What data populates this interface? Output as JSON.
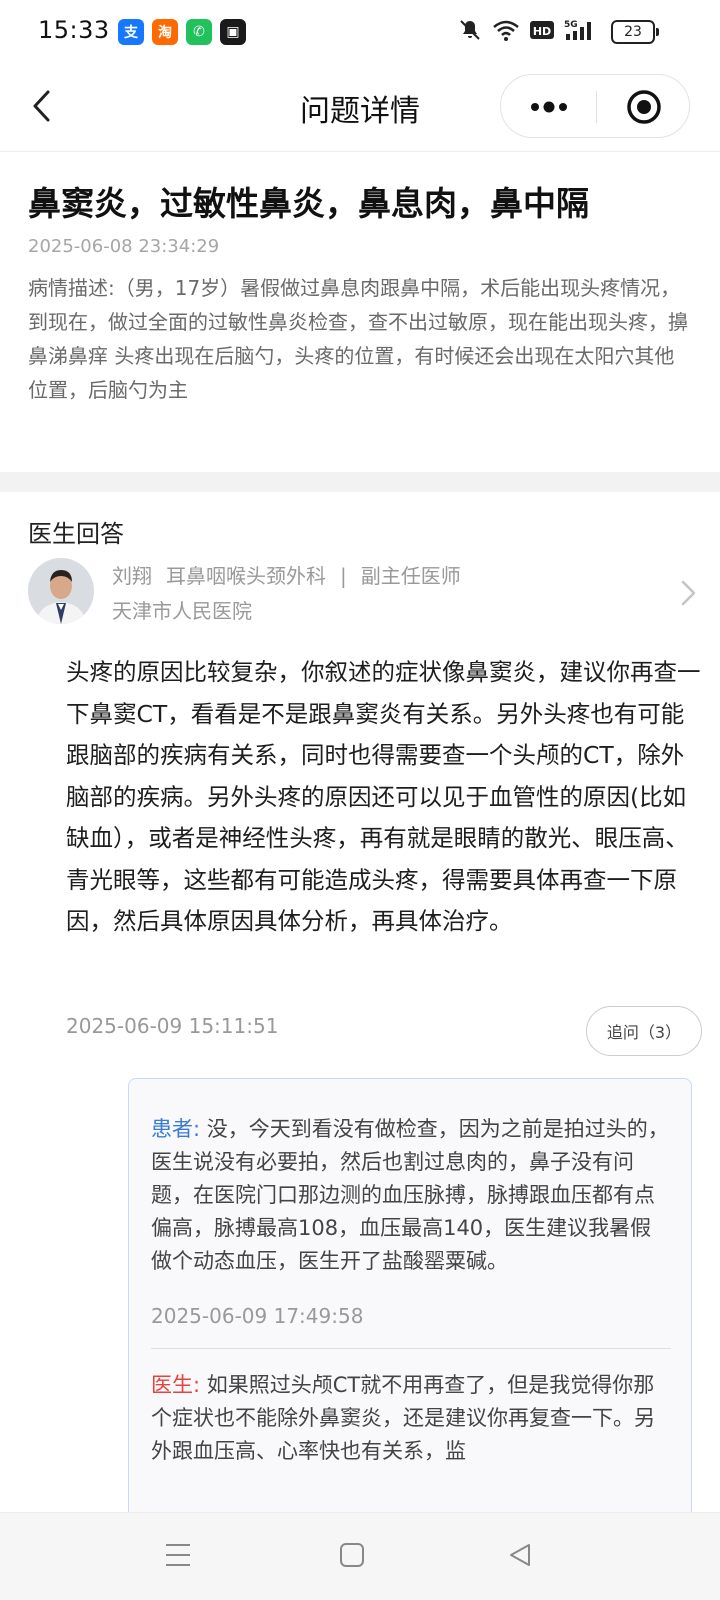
{
  "status_bar": {
    "time": "15:33",
    "apps": [
      {
        "name": "alipay-app-icon",
        "glyph": "支",
        "color": "#1677ff"
      },
      {
        "name": "taobao-app-icon",
        "glyph": "淘",
        "color": "#ff6a00"
      },
      {
        "name": "phone-app-icon",
        "glyph": "✆",
        "color": "#21c25e"
      },
      {
        "name": "recorder-app-icon",
        "glyph": "▣",
        "color": "#1a1a1a"
      }
    ],
    "battery": "23"
  },
  "nav": {
    "title": "问题详情"
  },
  "question": {
    "title": "鼻窦炎，过敏性鼻炎，鼻息肉，鼻中隔",
    "time": "2025-06-08 23:34:29",
    "description": "病情描述:（男，17岁）暑假做过鼻息肉跟鼻中隔，术后能出现头疼情况，到现在，做过全面的过敏性鼻炎检查，查不出过敏原，现在能出现头疼，擤鼻涕鼻痒 头疼出现在后脑勺，头疼的位置，有时候还会出现在太阳穴其他位置，后脑勺为主"
  },
  "answer": {
    "header": "医生回答",
    "doctor": {
      "name": "刘翔",
      "department": "耳鼻咽喉头颈外科",
      "separator": "|",
      "title": "副主任医师",
      "hospital": "天津市人民医院"
    },
    "text": "头疼的原因比较复杂，你叙述的症状像鼻窦炎，建议你再查一下鼻窦CT，看看是不是跟鼻窦炎有关系。另外头疼也有可能跟脑部的疾病有关系，同时也得需要查一个头颅的CT，除外脑部的疾病。另外头疼的原因还可以见于血管性的原因(比如缺血），或者是神经性头疼，再有就是眼睛的散光、眼压高、青光眼等，这些都有可能造成头疼，得需要具体再查一下原因，然后具体原因具体分析，再具体治疗。",
    "time": "2025-06-09 15:11:51",
    "followup_label": "追问（3）"
  },
  "followups": {
    "patient": {
      "role": "患者:",
      "text": " 没，今天到看没有做检查，因为之前是拍过头的，医生说没有必要拍，然后也割过息肉的，鼻子没有问题，在医院门口那边测的血压脉搏，脉搏跟血压都有点偏高，脉搏最高108，血压最高140，医生建议我暑假做个动态血压，医生开了盐酸罂粟碱。",
      "time": "2025-06-09 17:49:58"
    },
    "doctor": {
      "role": "医生:",
      "text": " 如果照过头颅CT就不用再查了，但是我觉得你那个症状也不能除外鼻窦炎，还是建议你再复查一下。另外跟血压高、心率快也有关系，监"
    }
  },
  "colors": {
    "patient_role": "#3a7bd5",
    "doctor_role": "#e2453c",
    "card_border": "#c9d9f6"
  }
}
